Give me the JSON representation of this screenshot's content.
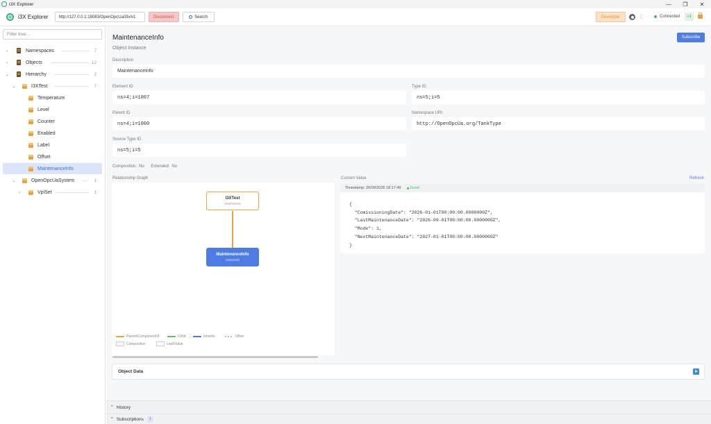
{
  "window": {
    "title": "i3X Explorer",
    "minimize_glyph": "—",
    "maximize_glyph": "❐",
    "close_glyph": "✕"
  },
  "header": {
    "brand": "i3X Explorer",
    "url_value": "http://127.0.0.1:18083/OpenOpcUa/i3x/v1",
    "disconnect_label": "Disconnect",
    "search_label": "Search",
    "developer_label": "Developer",
    "theme_glyph": "☾",
    "status_label": "Connected",
    "status_badge": "+1"
  },
  "sidebar": {
    "filter_placeholder": "Filter tree...",
    "items": [
      {
        "label": "Namespaces",
        "count": "7",
        "chev": "›"
      },
      {
        "label": "Objects",
        "count": "12",
        "chev": "›"
      },
      {
        "label": "Hierarchy",
        "count": "2",
        "chev": "⌄"
      },
      {
        "label": "I3XTest",
        "count": "7",
        "chev": "⌄"
      },
      {
        "label": "Temperature",
        "count": "",
        "chev": ""
      },
      {
        "label": "Level",
        "count": "",
        "chev": ""
      },
      {
        "label": "Counter",
        "count": "",
        "chev": ""
      },
      {
        "label": "Enabled",
        "count": "",
        "chev": ""
      },
      {
        "label": "Label",
        "count": "",
        "chev": ""
      },
      {
        "label": "Offset",
        "count": "",
        "chev": ""
      },
      {
        "label": "MaintenanceInfo",
        "count": "",
        "chev": ""
      },
      {
        "label": "OpenOpcUaSystem",
        "count": "1",
        "chev": "⌄"
      },
      {
        "label": "VpiSet",
        "count": "1",
        "chev": "›"
      }
    ]
  },
  "main": {
    "title": "MaintenanceInfo",
    "subtitle": "Object Instance",
    "subscribe_label": "Subscribe",
    "description_label": "Description",
    "description_value": "MaintenanceInfo",
    "element_id_label": "Element ID",
    "element_id_value": "ns=4;i=1007",
    "type_id_label": "Type ID",
    "type_id_value": "ns=5;i=5",
    "parent_id_label": "Parent ID",
    "parent_id_value": "ns=4;i=1000",
    "namespace_uri_label": "Namespace URI",
    "namespace_uri_value": "http://OpenOpcUa.org/TankType",
    "source_type_id_label": "Source Type ID",
    "source_type_id_value": "ns=5;i=5",
    "composition_label": "Composition:",
    "composition_value": "No",
    "extended_label": "Extended:",
    "extended_value": "No",
    "graph": {
      "label": "Relationship Graph",
      "parent_node_title": "I3XTest",
      "parent_node_sub": "(hasParent)",
      "selected_node_title": "MaintenanceInfo",
      "selected_node_sub": "(selected)",
      "legend": {
        "parent": "Parent/ComponentOf",
        "child": "Child",
        "inherits": "Inherits",
        "other": "Other",
        "composition": "Composition",
        "leaf": "Leaf/Value"
      }
    },
    "current_value": {
      "label": "Current Value",
      "refresh_label": "Refresh",
      "timestamp": "Timestamp: 26/09/2026 18:17:49",
      "quality": "Good",
      "json_lines": [
        "{",
        "  \"ComissioningDate\": \"2026-01-01T00:00:00.0000000Z\",",
        "  \"LastMaintenanceDate\": \"2026-09-01T00:00:00.0000000Z\",",
        "  \"Mode\": 1,",
        "  \"NextMaintenanceDate\": \"2027-01-01T00:00:00.0000000Z\"",
        "}"
      ]
    },
    "object_data_label": "Object Data",
    "history_label": "History",
    "subscriptions_label": "Subscriptions",
    "subscriptions_count": "1"
  },
  "colors": {
    "accent": "#4d7de4",
    "parent_edge": "#eba23c",
    "child_edge": "#5fbf6a",
    "inherits_edge": "#4d7de4",
    "danger": "#d94848",
    "success": "#3fbf5f"
  },
  "icons": {
    "app": "app-ring-icon",
    "search": "search-icon",
    "settings": "gear-icon",
    "theme": "moon-icon",
    "lock": "lock-icon",
    "folder": "namespace-book-icon",
    "object": "cube-icon",
    "play": "play-icon"
  }
}
